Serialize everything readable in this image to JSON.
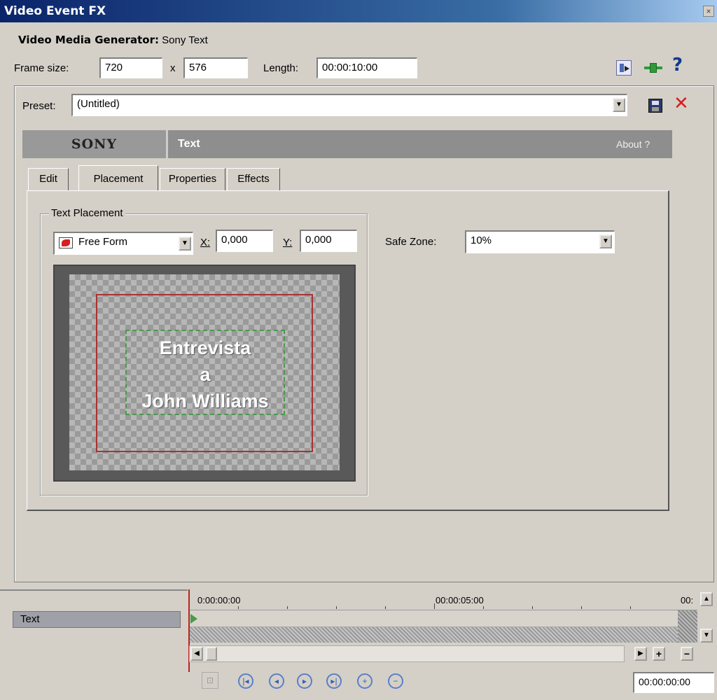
{
  "window": {
    "title": "Video Event FX",
    "close_glyph": "×"
  },
  "generator": {
    "label": "Video Media Generator:",
    "name": "Sony Text"
  },
  "frame": {
    "size_label": "Frame size:",
    "width": "720",
    "x_sep": "x",
    "height": "576",
    "length_label": "Length:",
    "length": "00:00:10:00"
  },
  "toolbar_icons": [
    "plugin-chooser-icon",
    "plugin-chain-icon",
    "help-icon"
  ],
  "help_glyph": "?",
  "preset": {
    "label": "Preset:",
    "value": "(Untitled)"
  },
  "banner": {
    "brand": "SONY",
    "title": "Text",
    "about": "About ?"
  },
  "tabs": [
    {
      "label": "Edit",
      "active": false
    },
    {
      "label": "Placement",
      "active": true
    },
    {
      "label": "Properties",
      "active": false
    },
    {
      "label": "Effects",
      "active": false
    }
  ],
  "placement": {
    "group_title": "Text Placement",
    "mode": "Free Form",
    "x_label": "X:",
    "x_value": "0,000",
    "y_label": "Y:",
    "y_value": "0,000",
    "safe_zone_label": "Safe Zone:",
    "safe_zone_value": "10%",
    "preview_lines": [
      "Entrevista",
      "a",
      "John Williams"
    ]
  },
  "timeline": {
    "track_name": "Text",
    "ruler": [
      "0:00:00:00",
      "00:00:05:00",
      "00:"
    ],
    "time_display": "00:00:00:00"
  },
  "colors": {
    "titlebar": "#0a246a",
    "safe_zone_rect": "#a83232",
    "text_bounds": "#4a9a4a",
    "delete_red": "#d42020",
    "chain_green": "#2e9a3a"
  }
}
